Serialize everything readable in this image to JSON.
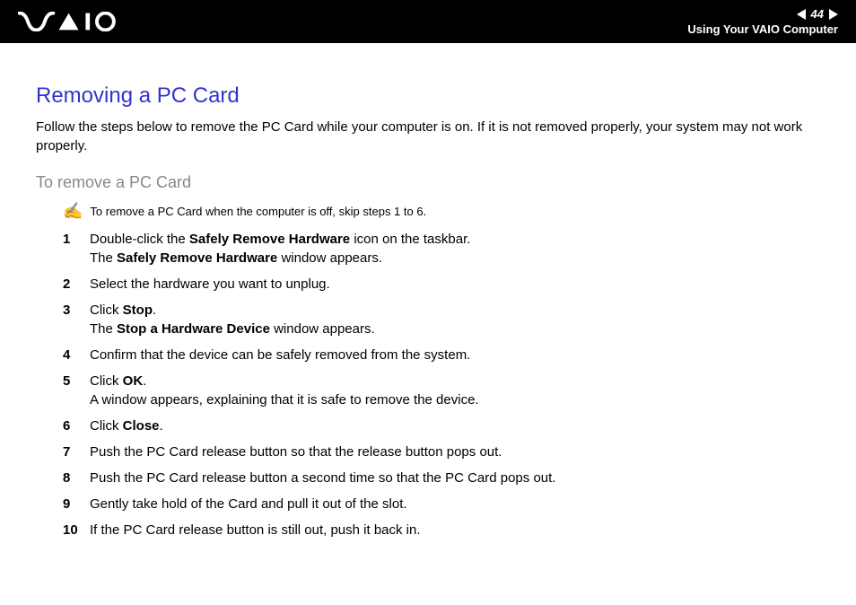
{
  "header": {
    "page_number": "44",
    "section_name": "Using Your VAIO Computer"
  },
  "content": {
    "heading": "Removing a PC Card",
    "intro": "Follow the steps below to remove the PC Card while your computer is on. If it is not removed properly, your system may not work properly.",
    "subheading": "To remove a PC Card",
    "note": "To remove a PC Card when the computer is off, skip steps 1 to 6.",
    "steps": [
      {
        "num": "1",
        "text_a": "Double-click the ",
        "bold_a": "Safely Remove Hardware",
        "text_b": " icon on the taskbar.",
        "br": true,
        "text_c": "The ",
        "bold_c": "Safely Remove Hardware",
        "text_d": " window appears."
      },
      {
        "num": "2",
        "text_a": "Select the hardware you want to unplug."
      },
      {
        "num": "3",
        "text_a": "Click ",
        "bold_a": "Stop",
        "text_b": ".",
        "br": true,
        "text_c": "The ",
        "bold_c": "Stop a Hardware Device",
        "text_d": " window appears."
      },
      {
        "num": "4",
        "text_a": "Confirm that the device can be safely removed from the system."
      },
      {
        "num": "5",
        "text_a": "Click ",
        "bold_a": "OK",
        "text_b": ".",
        "br": true,
        "text_c": "A window appears, explaining that it is safe to remove the device."
      },
      {
        "num": "6",
        "text_a": "Click ",
        "bold_a": "Close",
        "text_b": "."
      },
      {
        "num": "7",
        "text_a": "Push the PC Card release button so that the release button pops out."
      },
      {
        "num": "8",
        "text_a": "Push the PC Card release button a second time so that the PC Card pops out."
      },
      {
        "num": "9",
        "text_a": "Gently take hold of the Card and pull it out of the slot."
      },
      {
        "num": "10",
        "text_a": "If the PC Card release button is still out, push it back in."
      }
    ]
  }
}
